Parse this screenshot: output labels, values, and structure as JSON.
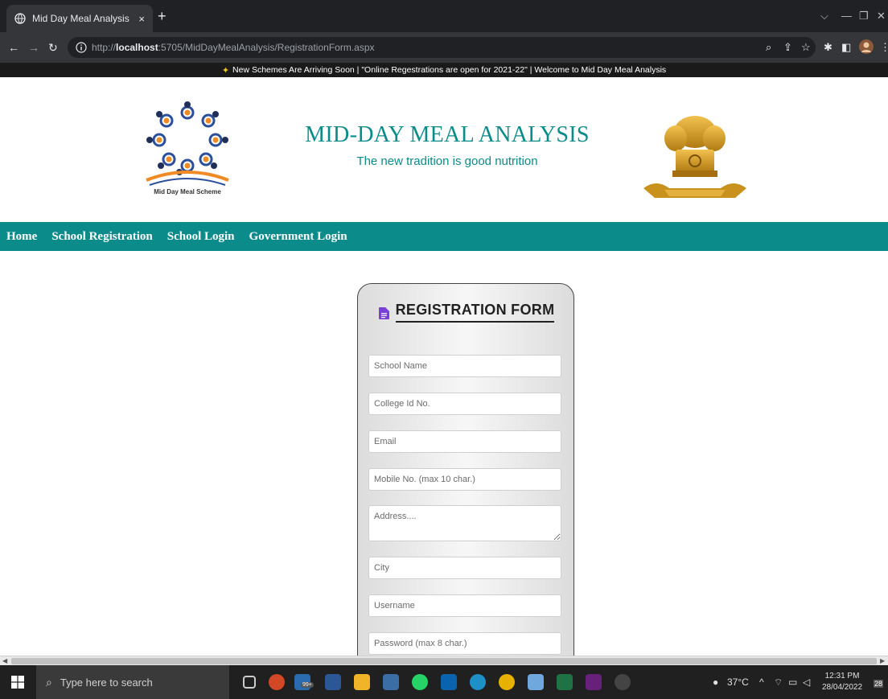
{
  "browser": {
    "tab_title": "Mid Day Meal Analysis",
    "tab_close": "×",
    "new_tab": "+",
    "url_prefix": "http://",
    "url_host": "localhost",
    "url_rest": ":5705/MidDayMealAnalysis/RegistrationForm.aspx",
    "icons": [
      "back-arrow-icon",
      "forward-arrow-icon",
      "reload-icon",
      "info-icon",
      "zoom-icon",
      "share-icon",
      "bookmark-star-icon",
      "extensions-icon",
      "sidebar-icon",
      "profile-icon",
      "menu-icon"
    ]
  },
  "marquee": {
    "text": "New Schemes Are Arriving Soon | \"Online Regestrations are open for 2021-22\" | Welcome to Mid Day Meal Analysis"
  },
  "header": {
    "logo_caption": "Mid Day Meal Scheme",
    "title": "MID-DAY MEAL ANALYSIS",
    "subtitle": "The new tradition is good nutrition"
  },
  "nav": {
    "items": [
      "Home",
      "School Registration",
      "School Login",
      "Government Login"
    ]
  },
  "form": {
    "title": "REGISTRATION FORM",
    "fields": {
      "school_name": "School Name",
      "college_id": "College Id No.",
      "email": "Email",
      "mobile": "Mobile No. (max 10 char.)",
      "address": "Address....",
      "city": "City",
      "username": "Username",
      "password": "Password (max 8 char.)"
    }
  },
  "taskbar": {
    "search_placeholder": "Type here to search",
    "weather": "37°C",
    "time": "12:31 PM",
    "date": "28/04/2022",
    "notification_count": "28",
    "store_badge": "99+"
  },
  "colors": {
    "accent": "#0c8b8b",
    "marquee_bg": "#1a1a1a",
    "chrome_dark": "#202124"
  }
}
